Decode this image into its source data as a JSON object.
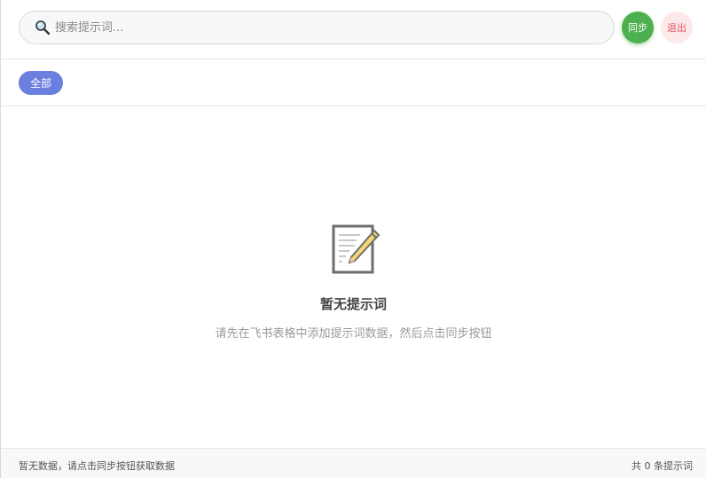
{
  "header": {
    "search_placeholder": "搜索提示词...",
    "sync_label": "同步",
    "logout_label": "退出"
  },
  "filters": {
    "all_label": "全部"
  },
  "empty_state": {
    "icon": "memo-pencil-icon",
    "title": "暂无提示词",
    "subtitle": "请先在飞书表格中添加提示词数据，然后点击同步按钮"
  },
  "footer": {
    "status": "暂无数据，请点击同步按钮获取数据",
    "count_text": "共 0 条提示词"
  },
  "colors": {
    "sync": "#4caf50",
    "logout_bg": "#fde8ea",
    "logout_text": "#e05a66",
    "chip": "#6b7fe0"
  }
}
